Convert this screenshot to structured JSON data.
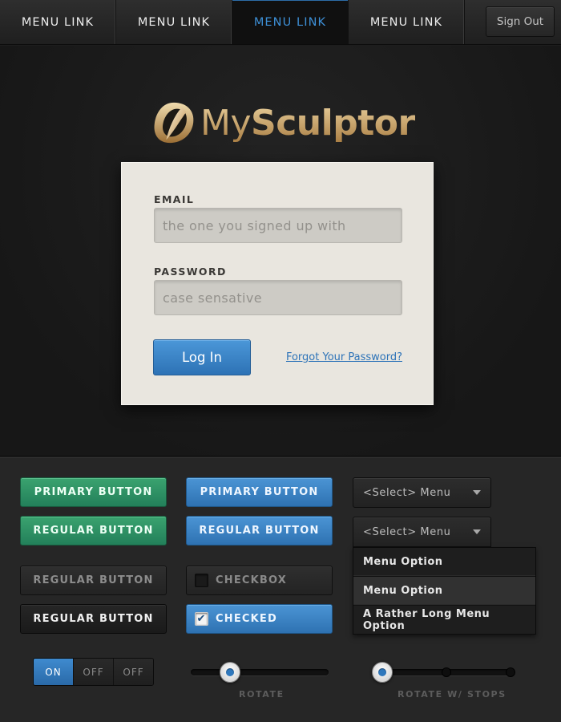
{
  "nav": {
    "links": [
      "MENU LINK",
      "MENU LINK",
      "MENU LINK",
      "MENU LINK"
    ],
    "active_index": 2,
    "sign_out": "Sign Out"
  },
  "brand": {
    "name_light": "My",
    "name_bold": "Sculptor",
    "gold": "#c9a36a"
  },
  "login": {
    "email_label": "EMAIL",
    "email_placeholder": "the one you signed up with",
    "password_label": "PASSWORD",
    "password_placeholder": "case sensative",
    "submit": "Log In",
    "forgot": "Forgot Your Password?"
  },
  "widgets": {
    "green_primary": "PRIMARY BUTTON",
    "green_regular": "REGULAR BUTTON",
    "blue_primary": "PRIMARY BUTTON",
    "blue_regular": "REGULAR BUTTON",
    "dark_regular_1": "REGULAR BUTTON",
    "dark_regular_2": "REGULAR BUTTON",
    "checkbox_unchecked": "CHECKBOX",
    "checkbox_checked": "CHECKED",
    "select_closed": "<Select>  Menu",
    "select_open": "<Select> Menu",
    "dropdown_options": [
      "Menu Option",
      "Menu Option",
      "A Rather Long Menu Option"
    ],
    "toggle": [
      "ON",
      "OFF",
      "OFF"
    ],
    "slider_rotate_label": "ROTATE",
    "slider_stops_label": "ROTATE W/ STOPS"
  },
  "colors": {
    "accent_blue": "#3d8fd6",
    "accent_green": "#2e9466",
    "background": "#1d1d1d"
  }
}
